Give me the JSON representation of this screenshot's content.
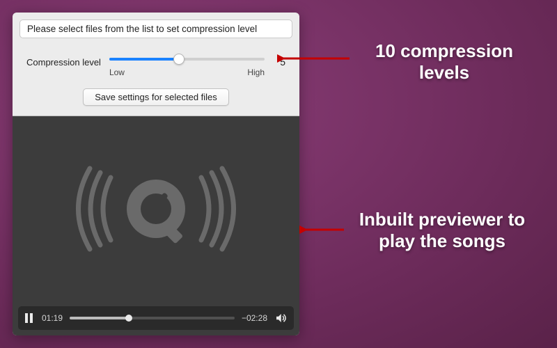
{
  "panel": {
    "instruction": "Please select files from the list to set compression level",
    "compression": {
      "label": "Compression level",
      "low": "Low",
      "high": "High",
      "value": "5"
    },
    "save_label": "Save settings for selected files"
  },
  "player": {
    "elapsed": "01:19",
    "remaining": "−02:28"
  },
  "callouts": {
    "levels": "10 compression levels",
    "previewer": "Inbuilt previewer to play the songs"
  },
  "colors": {
    "accent": "#1a82ff",
    "bg_panel": "#ececec",
    "bg_dark": "#3c3c3c"
  }
}
